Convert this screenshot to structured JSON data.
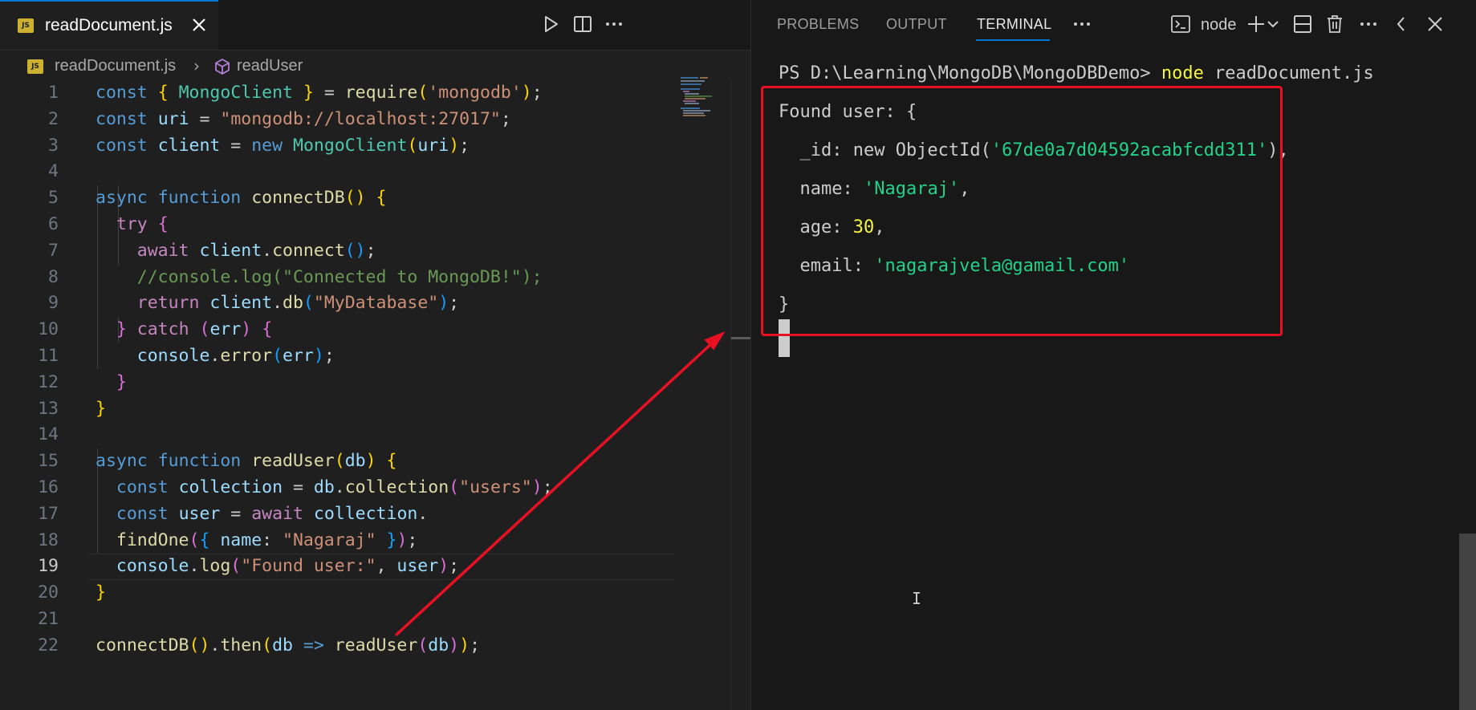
{
  "editor": {
    "tab": {
      "label": "readDocument.js",
      "icon_text": "JS"
    },
    "toolbar": [
      "run-icon",
      "split-editor-icon",
      "more-actions-icon"
    ],
    "breadcrumb": {
      "file": "readDocument.js",
      "separator": "›",
      "symbol": "readUser"
    },
    "current_line": 19,
    "lines": [
      {
        "n": "1",
        "tokens": [
          [
            "const",
            "k"
          ],
          [
            " ",
            "p"
          ],
          [
            "{",
            "b1"
          ],
          [
            " ",
            "p"
          ],
          [
            "MongoClient",
            "c"
          ],
          [
            " ",
            "p"
          ],
          [
            "}",
            "b1"
          ],
          [
            " = ",
            "p"
          ],
          [
            "require",
            "f"
          ],
          [
            "(",
            "b1"
          ],
          [
            "'mongodb'",
            "s"
          ],
          [
            ")",
            "b1"
          ],
          [
            ";",
            "p"
          ]
        ]
      },
      {
        "n": "2",
        "tokens": [
          [
            "const",
            "k"
          ],
          [
            " ",
            "p"
          ],
          [
            "uri",
            "v"
          ],
          [
            " = ",
            "p"
          ],
          [
            "\"mongodb://localhost:27017\"",
            "s"
          ],
          [
            ";",
            "p"
          ]
        ]
      },
      {
        "n": "3",
        "tokens": [
          [
            "const",
            "k"
          ],
          [
            " ",
            "p"
          ],
          [
            "client",
            "v"
          ],
          [
            " = ",
            "p"
          ],
          [
            "new",
            "k"
          ],
          [
            " ",
            "p"
          ],
          [
            "MongoClient",
            "c"
          ],
          [
            "(",
            "b1"
          ],
          [
            "uri",
            "v"
          ],
          [
            ")",
            "b1"
          ],
          [
            ";",
            "p"
          ]
        ]
      },
      {
        "n": "4",
        "tokens": []
      },
      {
        "n": "5",
        "tokens": [
          [
            "async",
            "k"
          ],
          [
            " ",
            "p"
          ],
          [
            "function",
            "k"
          ],
          [
            " ",
            "p"
          ],
          [
            "connectDB",
            "f"
          ],
          [
            "()",
            "b1"
          ],
          [
            " ",
            "p"
          ],
          [
            "{",
            "b1"
          ]
        ]
      },
      {
        "n": "6",
        "tokens": [
          [
            "  ",
            "p"
          ],
          [
            "try",
            "kc"
          ],
          [
            " ",
            "p"
          ],
          [
            "{",
            "b2"
          ]
        ]
      },
      {
        "n": "7",
        "tokens": [
          [
            "    ",
            "p"
          ],
          [
            "await",
            "kc"
          ],
          [
            " ",
            "p"
          ],
          [
            "client",
            "v"
          ],
          [
            ".",
            "p"
          ],
          [
            "connect",
            "f"
          ],
          [
            "()",
            "b3"
          ],
          [
            ";",
            "p"
          ]
        ]
      },
      {
        "n": "8",
        "tokens": [
          [
            "    ",
            "p"
          ],
          [
            "//console.log(\"Connected to MongoDB!\");",
            "cm"
          ]
        ]
      },
      {
        "n": "9",
        "tokens": [
          [
            "    ",
            "p"
          ],
          [
            "return",
            "kc"
          ],
          [
            " ",
            "p"
          ],
          [
            "client",
            "v"
          ],
          [
            ".",
            "p"
          ],
          [
            "db",
            "f"
          ],
          [
            "(",
            "b3"
          ],
          [
            "\"MyDatabase\"",
            "s"
          ],
          [
            ")",
            "b3"
          ],
          [
            ";",
            "p"
          ]
        ]
      },
      {
        "n": "10",
        "tokens": [
          [
            "  ",
            "p"
          ],
          [
            "}",
            "b2"
          ],
          [
            " ",
            "p"
          ],
          [
            "catch",
            "kc"
          ],
          [
            " ",
            "p"
          ],
          [
            "(",
            "b2"
          ],
          [
            "err",
            "v"
          ],
          [
            ")",
            "b2"
          ],
          [
            " ",
            "p"
          ],
          [
            "{",
            "b2"
          ]
        ]
      },
      {
        "n": "11",
        "tokens": [
          [
            "    ",
            "p"
          ],
          [
            "console",
            "v"
          ],
          [
            ".",
            "p"
          ],
          [
            "error",
            "f"
          ],
          [
            "(",
            "b3"
          ],
          [
            "err",
            "v"
          ],
          [
            ")",
            "b3"
          ],
          [
            ";",
            "p"
          ]
        ]
      },
      {
        "n": "12",
        "tokens": [
          [
            "  ",
            "p"
          ],
          [
            "}",
            "b2"
          ]
        ]
      },
      {
        "n": "13",
        "tokens": [
          [
            "}",
            "b1"
          ]
        ]
      },
      {
        "n": "14",
        "tokens": []
      },
      {
        "n": "15",
        "tokens": [
          [
            "async",
            "k"
          ],
          [
            " ",
            "p"
          ],
          [
            "function",
            "k"
          ],
          [
            " ",
            "p"
          ],
          [
            "readUser",
            "f"
          ],
          [
            "(",
            "b1"
          ],
          [
            "db",
            "v"
          ],
          [
            ")",
            "b1"
          ],
          [
            " ",
            "p"
          ],
          [
            "{",
            "b1"
          ]
        ]
      },
      {
        "n": "16",
        "tokens": [
          [
            "  ",
            "p"
          ],
          [
            "const",
            "k"
          ],
          [
            " ",
            "p"
          ],
          [
            "collection",
            "v"
          ],
          [
            " = ",
            "p"
          ],
          [
            "db",
            "v"
          ],
          [
            ".",
            "p"
          ],
          [
            "collection",
            "f"
          ],
          [
            "(",
            "b2"
          ],
          [
            "\"users\"",
            "s"
          ],
          [
            ")",
            "b2"
          ],
          [
            ";",
            "p"
          ]
        ]
      },
      {
        "n": "17",
        "tokens": [
          [
            "  ",
            "p"
          ],
          [
            "const",
            "k"
          ],
          [
            " ",
            "p"
          ],
          [
            "user",
            "v"
          ],
          [
            " = ",
            "p"
          ],
          [
            "await",
            "kc"
          ],
          [
            " ",
            "p"
          ],
          [
            "collection",
            "v"
          ],
          [
            ".",
            "p"
          ]
        ]
      },
      {
        "n": "18",
        "tokens": [
          [
            "  ",
            "p"
          ],
          [
            "findOne",
            "f"
          ],
          [
            "(",
            "b2"
          ],
          [
            "{",
            "b3"
          ],
          [
            " ",
            "p"
          ],
          [
            "name",
            "v"
          ],
          [
            ": ",
            "p"
          ],
          [
            "\"Nagaraj\"",
            "s"
          ],
          [
            " ",
            "p"
          ],
          [
            "}",
            "b3"
          ],
          [
            ")",
            "b2"
          ],
          [
            ";",
            "p"
          ]
        ]
      },
      {
        "n": "19",
        "tokens": [
          [
            "  ",
            "p"
          ],
          [
            "console",
            "v"
          ],
          [
            ".",
            "p"
          ],
          [
            "log",
            "f"
          ],
          [
            "(",
            "b2"
          ],
          [
            "\"Found user:\"",
            "s"
          ],
          [
            ", ",
            "p"
          ],
          [
            "user",
            "v"
          ],
          [
            ")",
            "b2"
          ],
          [
            ";",
            "p"
          ]
        ]
      },
      {
        "n": "20",
        "tokens": [
          [
            "}",
            "b1"
          ]
        ]
      },
      {
        "n": "21",
        "tokens": []
      },
      {
        "n": "22",
        "tokens": [
          [
            "connectDB",
            "f"
          ],
          [
            "()",
            "b1"
          ],
          [
            ".",
            "p"
          ],
          [
            "then",
            "f"
          ],
          [
            "(",
            "b1"
          ],
          [
            "db",
            "v"
          ],
          [
            " ",
            "p"
          ],
          [
            "=>",
            "k"
          ],
          [
            " ",
            "p"
          ],
          [
            "readUser",
            "f"
          ],
          [
            "(",
            "b2"
          ],
          [
            "db",
            "v"
          ],
          [
            ")",
            "b2"
          ],
          [
            ")",
            "b1"
          ],
          [
            ";",
            "p"
          ]
        ]
      }
    ]
  },
  "panel": {
    "tabs": [
      {
        "label": "PROBLEMS",
        "active": false
      },
      {
        "label": "OUTPUT",
        "active": false
      },
      {
        "label": "TERMINAL",
        "active": true
      }
    ],
    "terminal_name": "node",
    "actions": [
      "more-icon",
      "terminal-icon",
      "add-terminal-icon",
      "chevron-down-icon",
      "split-terminal-icon",
      "trash-icon",
      "more-actions-icon",
      "collapse-icon",
      "close-icon"
    ],
    "terminal_lines": [
      [
        [
          "PS D:\\Learning\\MongoDB\\MongoDBDemo> ",
          "p"
        ],
        [
          "node",
          "t-cmd"
        ],
        [
          " readDocument.js",
          "p"
        ]
      ],
      [
        [
          "Found user: {",
          "p"
        ]
      ],
      [
        [
          "  _id: new ObjectId(",
          "p"
        ],
        [
          "'67de0a7d04592acabfcdd311'",
          "t-str"
        ],
        [
          "),",
          "p"
        ]
      ],
      [
        [
          "  name: ",
          "p"
        ],
        [
          "'Nagaraj'",
          "t-str"
        ],
        [
          ",",
          "p"
        ]
      ],
      [
        [
          "  age: ",
          "p"
        ],
        [
          "30",
          "t-num"
        ],
        [
          ",",
          "p"
        ]
      ],
      [
        [
          "  email: ",
          "p"
        ],
        [
          "'nagarajvela@gamail.com'",
          "t-str"
        ]
      ],
      [
        [
          "}",
          "p"
        ]
      ]
    ]
  },
  "colors": {
    "accent": "#0078d4",
    "annotation_red": "#e81123",
    "editor_bg": "#1f1f1f",
    "panel_bg": "#181818"
  }
}
